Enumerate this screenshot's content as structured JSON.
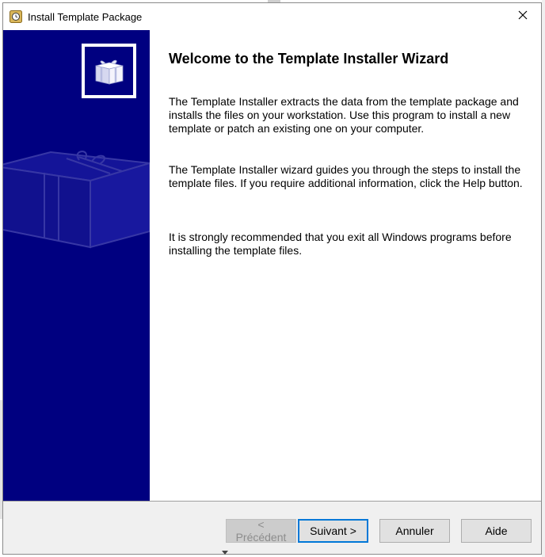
{
  "window": {
    "title": "Install Template Package",
    "close_glyph": "✕",
    "icon": "template-package-app-icon"
  },
  "sidebar": {
    "background_color": "#000080",
    "logo_icon": "gift-box-icon",
    "watermark_icon": "gift-box-watermark-icon"
  },
  "content": {
    "heading": "Welcome to the Template Installer Wizard",
    "paragraphs": [
      "The Template Installer extracts the data from the template package and installs the files on your workstation. Use this program to install a new template or patch an existing one on your computer.",
      "The Template Installer wizard guides you through the steps to install the template files. If you require additional information, click the Help button.",
      "It is strongly recommended that you exit all Windows programs before installing the template files."
    ]
  },
  "footer": {
    "back_label": "< Précédent",
    "next_label": "Suivant >",
    "cancel_label": "Annuler",
    "help_label": "Aide",
    "accent_color": "#0078d7"
  }
}
